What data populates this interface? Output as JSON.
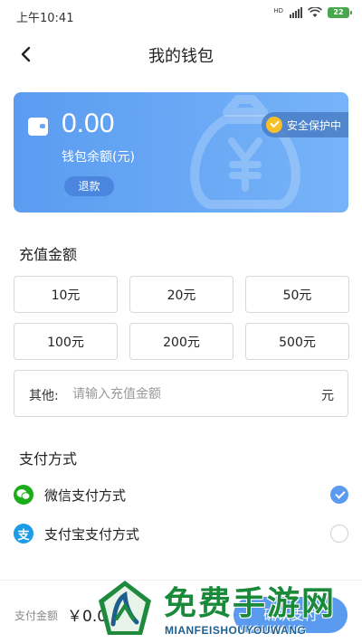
{
  "status_bar": {
    "time": "上午10:41",
    "network": "HD",
    "battery": "22"
  },
  "nav": {
    "title": "我的钱包",
    "back_icon": "chevron-left-icon"
  },
  "wallet": {
    "balance": "0.00",
    "balance_label": "钱包余额(元)",
    "refund_button": "退款",
    "security_badge": "安全保护中",
    "card_gradient": [
      "#5b9cf1",
      "#76b3f8"
    ]
  },
  "recharge": {
    "section_title": "充值金额",
    "amounts": [
      "10元",
      "20元",
      "50元",
      "100元",
      "200元",
      "500元"
    ],
    "other_label": "其他:",
    "other_placeholder": "请输入充值金额",
    "other_value": "",
    "other_unit": "元"
  },
  "payment": {
    "section_title": "支付方式",
    "methods": [
      {
        "label": "微信支付方式",
        "icon": "wechat-icon",
        "selected": true
      },
      {
        "label": "支付宝支付方式",
        "icon": "alipay-icon",
        "selected": false
      }
    ]
  },
  "bottom": {
    "pay_amount_label": "支付金额",
    "pay_amount": "￥0.00",
    "confirm_button": "确认支付"
  },
  "watermark": {
    "text": "免费手游网",
    "subtext": "MIANFEISHOUYOUWANG"
  },
  "colors": {
    "accent": "#5a9bf0",
    "wechat": "#1aad19",
    "alipay": "#1d9ce6",
    "badge_check": "#f6c026"
  }
}
